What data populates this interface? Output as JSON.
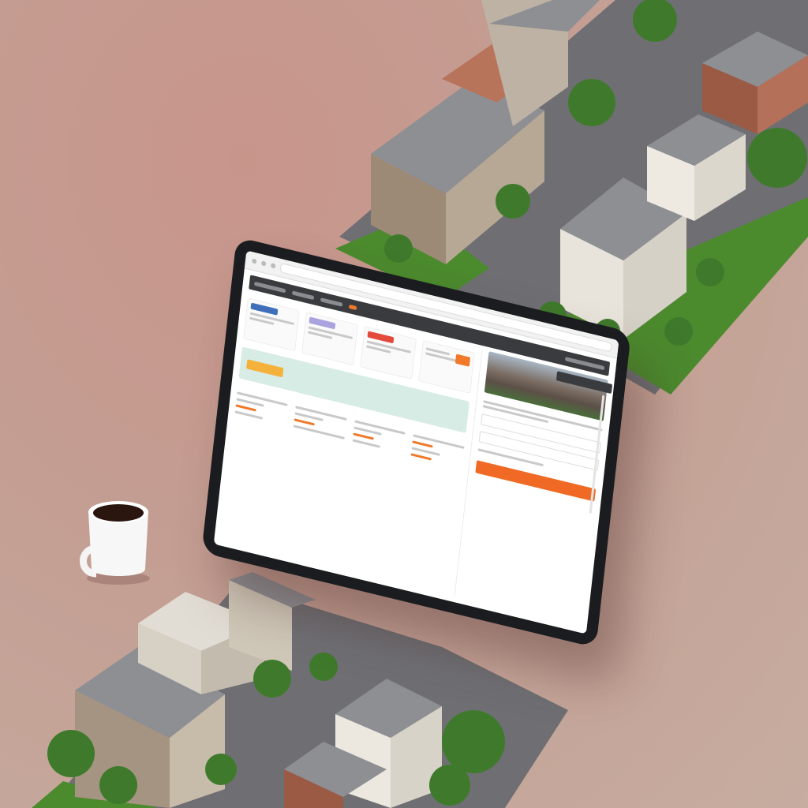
{
  "scene": {
    "subject": "monitor-with-real-estate-listing-ui",
    "palette": {
      "background": "#c8958b",
      "monitor_bezel": "#1b1c1f",
      "accent_orange": "#f07a2a",
      "accent_yellow": "#f4b23c",
      "mint_band": "#d8ece6",
      "roof_gray": "#8e8f93",
      "grass_green": "#4c8a2e"
    },
    "icons": {
      "mug": "coffee-mug-icon",
      "tree": "tree-icon"
    }
  }
}
